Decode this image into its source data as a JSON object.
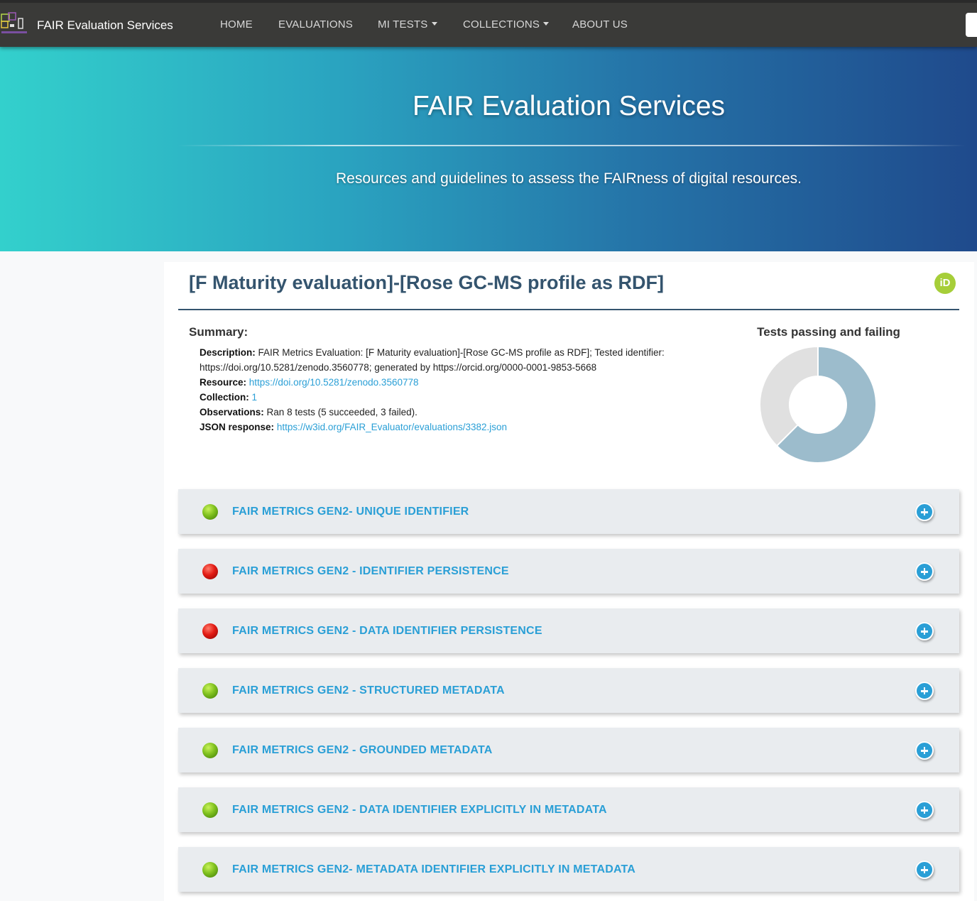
{
  "navbar": {
    "brand": "FAIR Evaluation Services",
    "items": [
      {
        "label": "HOME",
        "dropdown": false
      },
      {
        "label": "EVALUATIONS",
        "dropdown": false
      },
      {
        "label": "MI TESTS",
        "dropdown": true
      },
      {
        "label": "COLLECTIONS",
        "dropdown": true
      },
      {
        "label": "ABOUT US",
        "dropdown": false
      }
    ]
  },
  "hero": {
    "title": "FAIR Evaluation Services",
    "subtitle": "Resources and guidelines to assess the FAIRness of digital resources."
  },
  "evaluation": {
    "title": "[F Maturity evaluation]-[Rose GC-MS profile as RDF]",
    "orcid_icon": "iD",
    "summary": {
      "heading": "Summary:",
      "description_label": "Description:",
      "description": "FAIR Metrics Evaluation: [F Maturity evaluation]-[Rose GC-MS profile as RDF]; Tested identifier: https://doi.org/10.5281/zenodo.3560778; generated by https://orcid.org/0000-0001-9853-5668",
      "resource_label": "Resource:",
      "resource": "https://doi.org/10.5281/zenodo.3560778",
      "collection_label": "Collection:",
      "collection": "1",
      "observations_label": "Observations:",
      "observations": "Ran 8 tests (5 succeeded, 3 failed).",
      "json_label": "JSON response:",
      "json_url": "https://w3id.org/FAIR_Evaluator/evaluations/3382.json"
    }
  },
  "chart_data": {
    "type": "pie",
    "title": "Tests passing and failing",
    "categories": [
      "passing",
      "failing"
    ],
    "values": [
      5,
      3
    ],
    "colors": [
      "#9cbccc",
      "#e0e0e0"
    ],
    "donut": true
  },
  "tests": [
    {
      "label": "FAIR METRICS GEN2- UNIQUE IDENTIFIER",
      "status": "pass"
    },
    {
      "label": "FAIR METRICS GEN2 - IDENTIFIER PERSISTENCE",
      "status": "fail"
    },
    {
      "label": "FAIR METRICS GEN2 - DATA IDENTIFIER PERSISTENCE",
      "status": "fail"
    },
    {
      "label": "FAIR METRICS GEN2 - STRUCTURED METADATA",
      "status": "pass"
    },
    {
      "label": "FAIR METRICS GEN2 - GROUNDED METADATA",
      "status": "pass"
    },
    {
      "label": "FAIR METRICS GEN2 - DATA IDENTIFIER EXPLICITLY IN METADATA",
      "status": "pass"
    },
    {
      "label": "FAIR METRICS GEN2- METADATA IDENTIFIER EXPLICITLY IN METADATA",
      "status": "pass"
    }
  ]
}
